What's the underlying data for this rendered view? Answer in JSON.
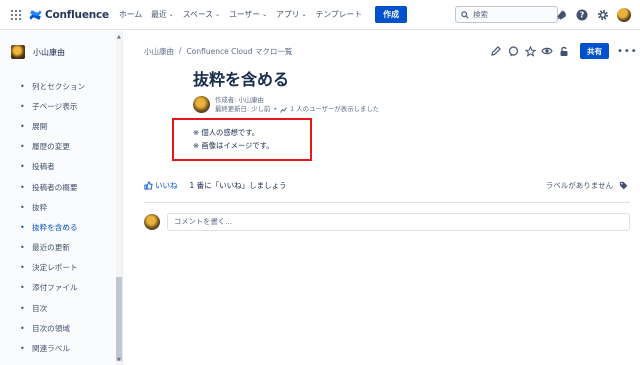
{
  "topnav": {
    "app_name": "Confluence",
    "menu": [
      {
        "label": "ホーム",
        "has_dropdown": false
      },
      {
        "label": "最近",
        "has_dropdown": true
      },
      {
        "label": "スペース",
        "has_dropdown": true
      },
      {
        "label": "ユーザー",
        "has_dropdown": true
      },
      {
        "label": "アプリ",
        "has_dropdown": true
      },
      {
        "label": "テンプレート",
        "has_dropdown": false
      }
    ],
    "create_label": "作成",
    "search_placeholder": "検索",
    "icons": [
      "notifications-icon",
      "help-icon",
      "settings-icon",
      "profile-avatar"
    ],
    "chevron": "⌄"
  },
  "sidebar": {
    "space_name": "小山康由",
    "items": [
      {
        "label": "列とセクション",
        "active": false
      },
      {
        "label": "子ページ表示",
        "active": false
      },
      {
        "label": "展開",
        "active": false
      },
      {
        "label": "履歴の変更",
        "active": false
      },
      {
        "label": "投稿者",
        "active": false
      },
      {
        "label": "投稿者の概要",
        "active": false
      },
      {
        "label": "抜粋",
        "active": false
      },
      {
        "label": "抜粋を含める",
        "active": true
      },
      {
        "label": "最近の更新",
        "active": false
      },
      {
        "label": "決定レポート",
        "active": false
      },
      {
        "label": "添付ファイル",
        "active": false
      },
      {
        "label": "目次",
        "active": false
      },
      {
        "label": "目次の領域",
        "active": false
      },
      {
        "label": "関連ラベル",
        "active": false
      }
    ]
  },
  "breadcrumb": {
    "items": [
      "小山康由",
      "Confluence Cloud マクロ一覧"
    ],
    "separator": "/"
  },
  "page_actions": {
    "share_label": "共有",
    "more": "•••"
  },
  "page": {
    "title": "抜粋を含める",
    "created_by": "作成者: 小山康由",
    "last_updated": "最終更新日: 少し前",
    "views": "1 人のユーザーが表示しました",
    "meta_separator": "•",
    "body_lines": [
      "※ 個人の感想です。",
      "※ 画像はイメージです。"
    ]
  },
  "footer": {
    "like_label": "いいね",
    "like_hint": "1 番に「いいね」しましょう",
    "no_labels": "ラベルがありません",
    "comment_placeholder": "コメントを書く..."
  },
  "colors": {
    "primary": "#0052cc",
    "highlight_border": "#e8151b",
    "text": "#172b4d",
    "subtle_text": "#5e6c84"
  }
}
